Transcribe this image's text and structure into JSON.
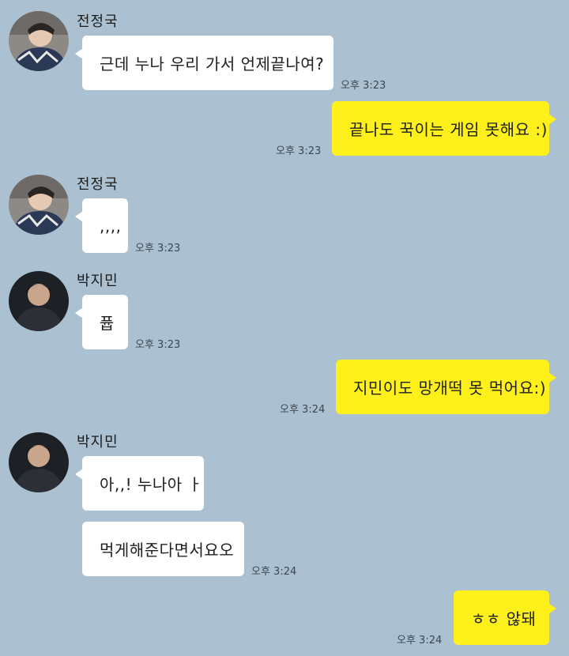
{
  "chat": {
    "messages": [
      {
        "sender": "전정국",
        "text": "근데 누나 우리 가서 언제끝나여?",
        "time": "오후 3:23"
      },
      {
        "text": "끝나도 꾹이는 게임 못해요 :)",
        "time": "오후 3:23"
      },
      {
        "sender": "전정국",
        "text": ",,,,",
        "time": "오후 3:23"
      },
      {
        "sender": "박지민",
        "text": "퓹",
        "time": "오후 3:23"
      },
      {
        "text": "지민이도 망개떡 못 먹어요:)",
        "time": "오후 3:24"
      },
      {
        "sender": "박지민",
        "text": "아,,! 누나아 ㅏ"
      },
      {
        "text": "먹게해준다면서요오",
        "time": "오후 3:24"
      },
      {
        "text": "ㅎㅎ 않돼",
        "time": "오후 3:24"
      }
    ]
  },
  "colors": {
    "background": "#abc1d1",
    "incoming_bubble": "#ffffff",
    "outgoing_bubble": "#fef01b"
  },
  "icons": {
    "avatar_jungkook": "profile-photo-jungkook",
    "avatar_jimin": "profile-photo-jimin"
  }
}
